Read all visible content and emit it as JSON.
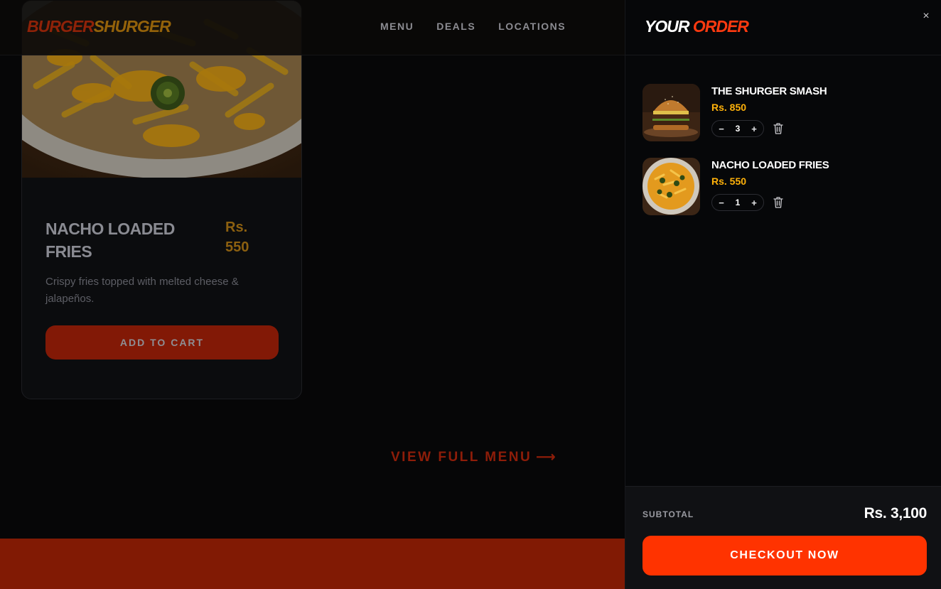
{
  "brand": {
    "part1": "BURGER",
    "part2": "SHURGER"
  },
  "nav": {
    "items": [
      "MENU",
      "DEALS",
      "LOCATIONS"
    ]
  },
  "product_card": {
    "title": "NACHO LOADED FRIES",
    "price_currency": "Rs.",
    "price_value": "550",
    "description": "Crispy fries topped with melted cheese & jalapeños.",
    "button_label": "ADD TO CART"
  },
  "view_menu": {
    "label": "VIEW FULL MENU",
    "arrow": "⟶"
  },
  "cart": {
    "title_part1": "YOUR",
    "title_part2": "ORDER",
    "close_icon": "×",
    "items": [
      {
        "name": "THE SHURGER SMASH",
        "price": "Rs. 850",
        "qty": "3",
        "image": "burger"
      },
      {
        "name": "NACHO LOADED FRIES",
        "price": "Rs. 550",
        "qty": "1",
        "image": "fries"
      }
    ],
    "subtotal_label": "SUBTOTAL",
    "subtotal_value": "Rs. 3,100",
    "checkout_label": "CHECKOUT NOW"
  },
  "colors": {
    "accent": "#ff3300",
    "price": "#ffb20a",
    "background": "#060709"
  }
}
